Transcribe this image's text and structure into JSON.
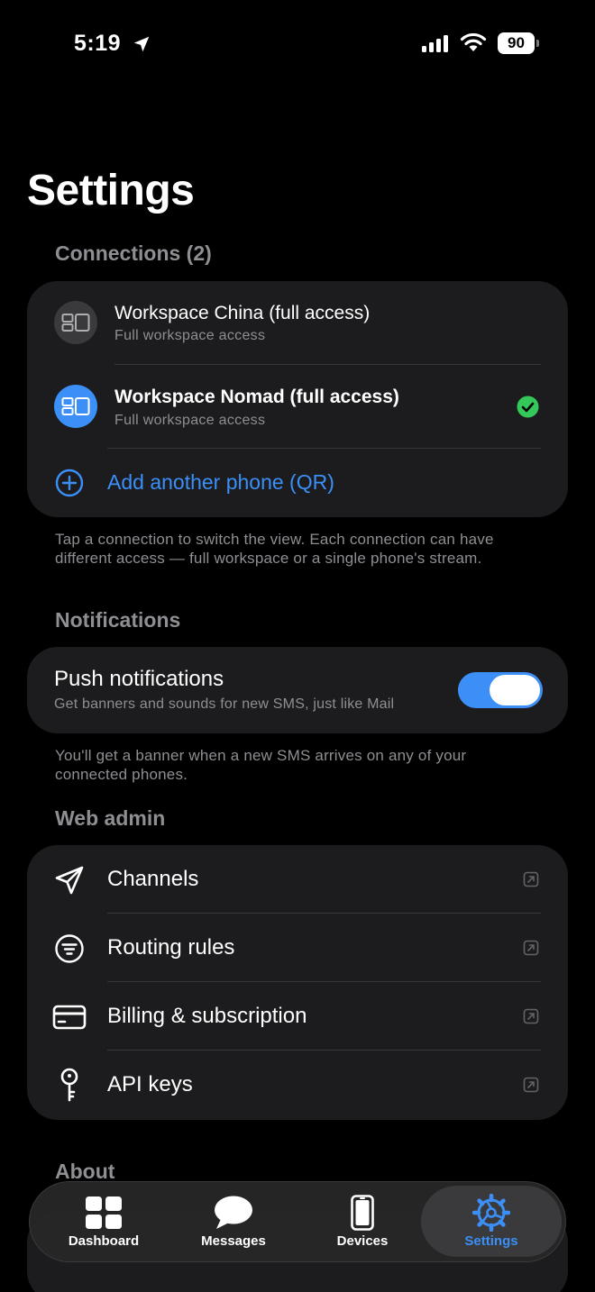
{
  "status_bar": {
    "time": "5:19",
    "battery": "90"
  },
  "page_title": "Settings",
  "connections": {
    "header": "Connections (2)",
    "items": [
      {
        "title": "Workspace China (full access)",
        "subtitle": "Full workspace access",
        "selected": false
      },
      {
        "title": "Workspace Nomad (full access)",
        "subtitle": "Full workspace access",
        "selected": true
      }
    ],
    "add_label": "Add another phone (QR)",
    "footnote": "Tap a connection to switch the view. Each connection can have different access — full workspace or a single phone's stream."
  },
  "notifications": {
    "header": "Notifications",
    "push_title": "Push notifications",
    "push_subtitle": "Get banners and sounds for new SMS, just like Mail",
    "push_enabled": true,
    "footnote": "You'll get a banner when a new SMS arrives on any of your connected phones."
  },
  "web_admin": {
    "header": "Web admin",
    "items": [
      {
        "label": "Channels",
        "icon": "paper-plane-icon"
      },
      {
        "label": "Routing rules",
        "icon": "filter-icon"
      },
      {
        "label": "Billing & subscription",
        "icon": "credit-card-icon"
      },
      {
        "label": "API keys",
        "icon": "key-icon"
      }
    ]
  },
  "about": {
    "header": "About"
  },
  "tab_bar": {
    "tabs": [
      {
        "label": "Dashboard",
        "icon": "grid-icon"
      },
      {
        "label": "Messages",
        "icon": "chat-bubble-icon"
      },
      {
        "label": "Devices",
        "icon": "phone-icon"
      },
      {
        "label": "Settings",
        "icon": "gear-icon",
        "active": true
      }
    ]
  },
  "colors": {
    "accent": "#3b8ff7",
    "success": "#34c759",
    "card": "#1c1c1e",
    "secondary_text": "#8e8e93"
  }
}
